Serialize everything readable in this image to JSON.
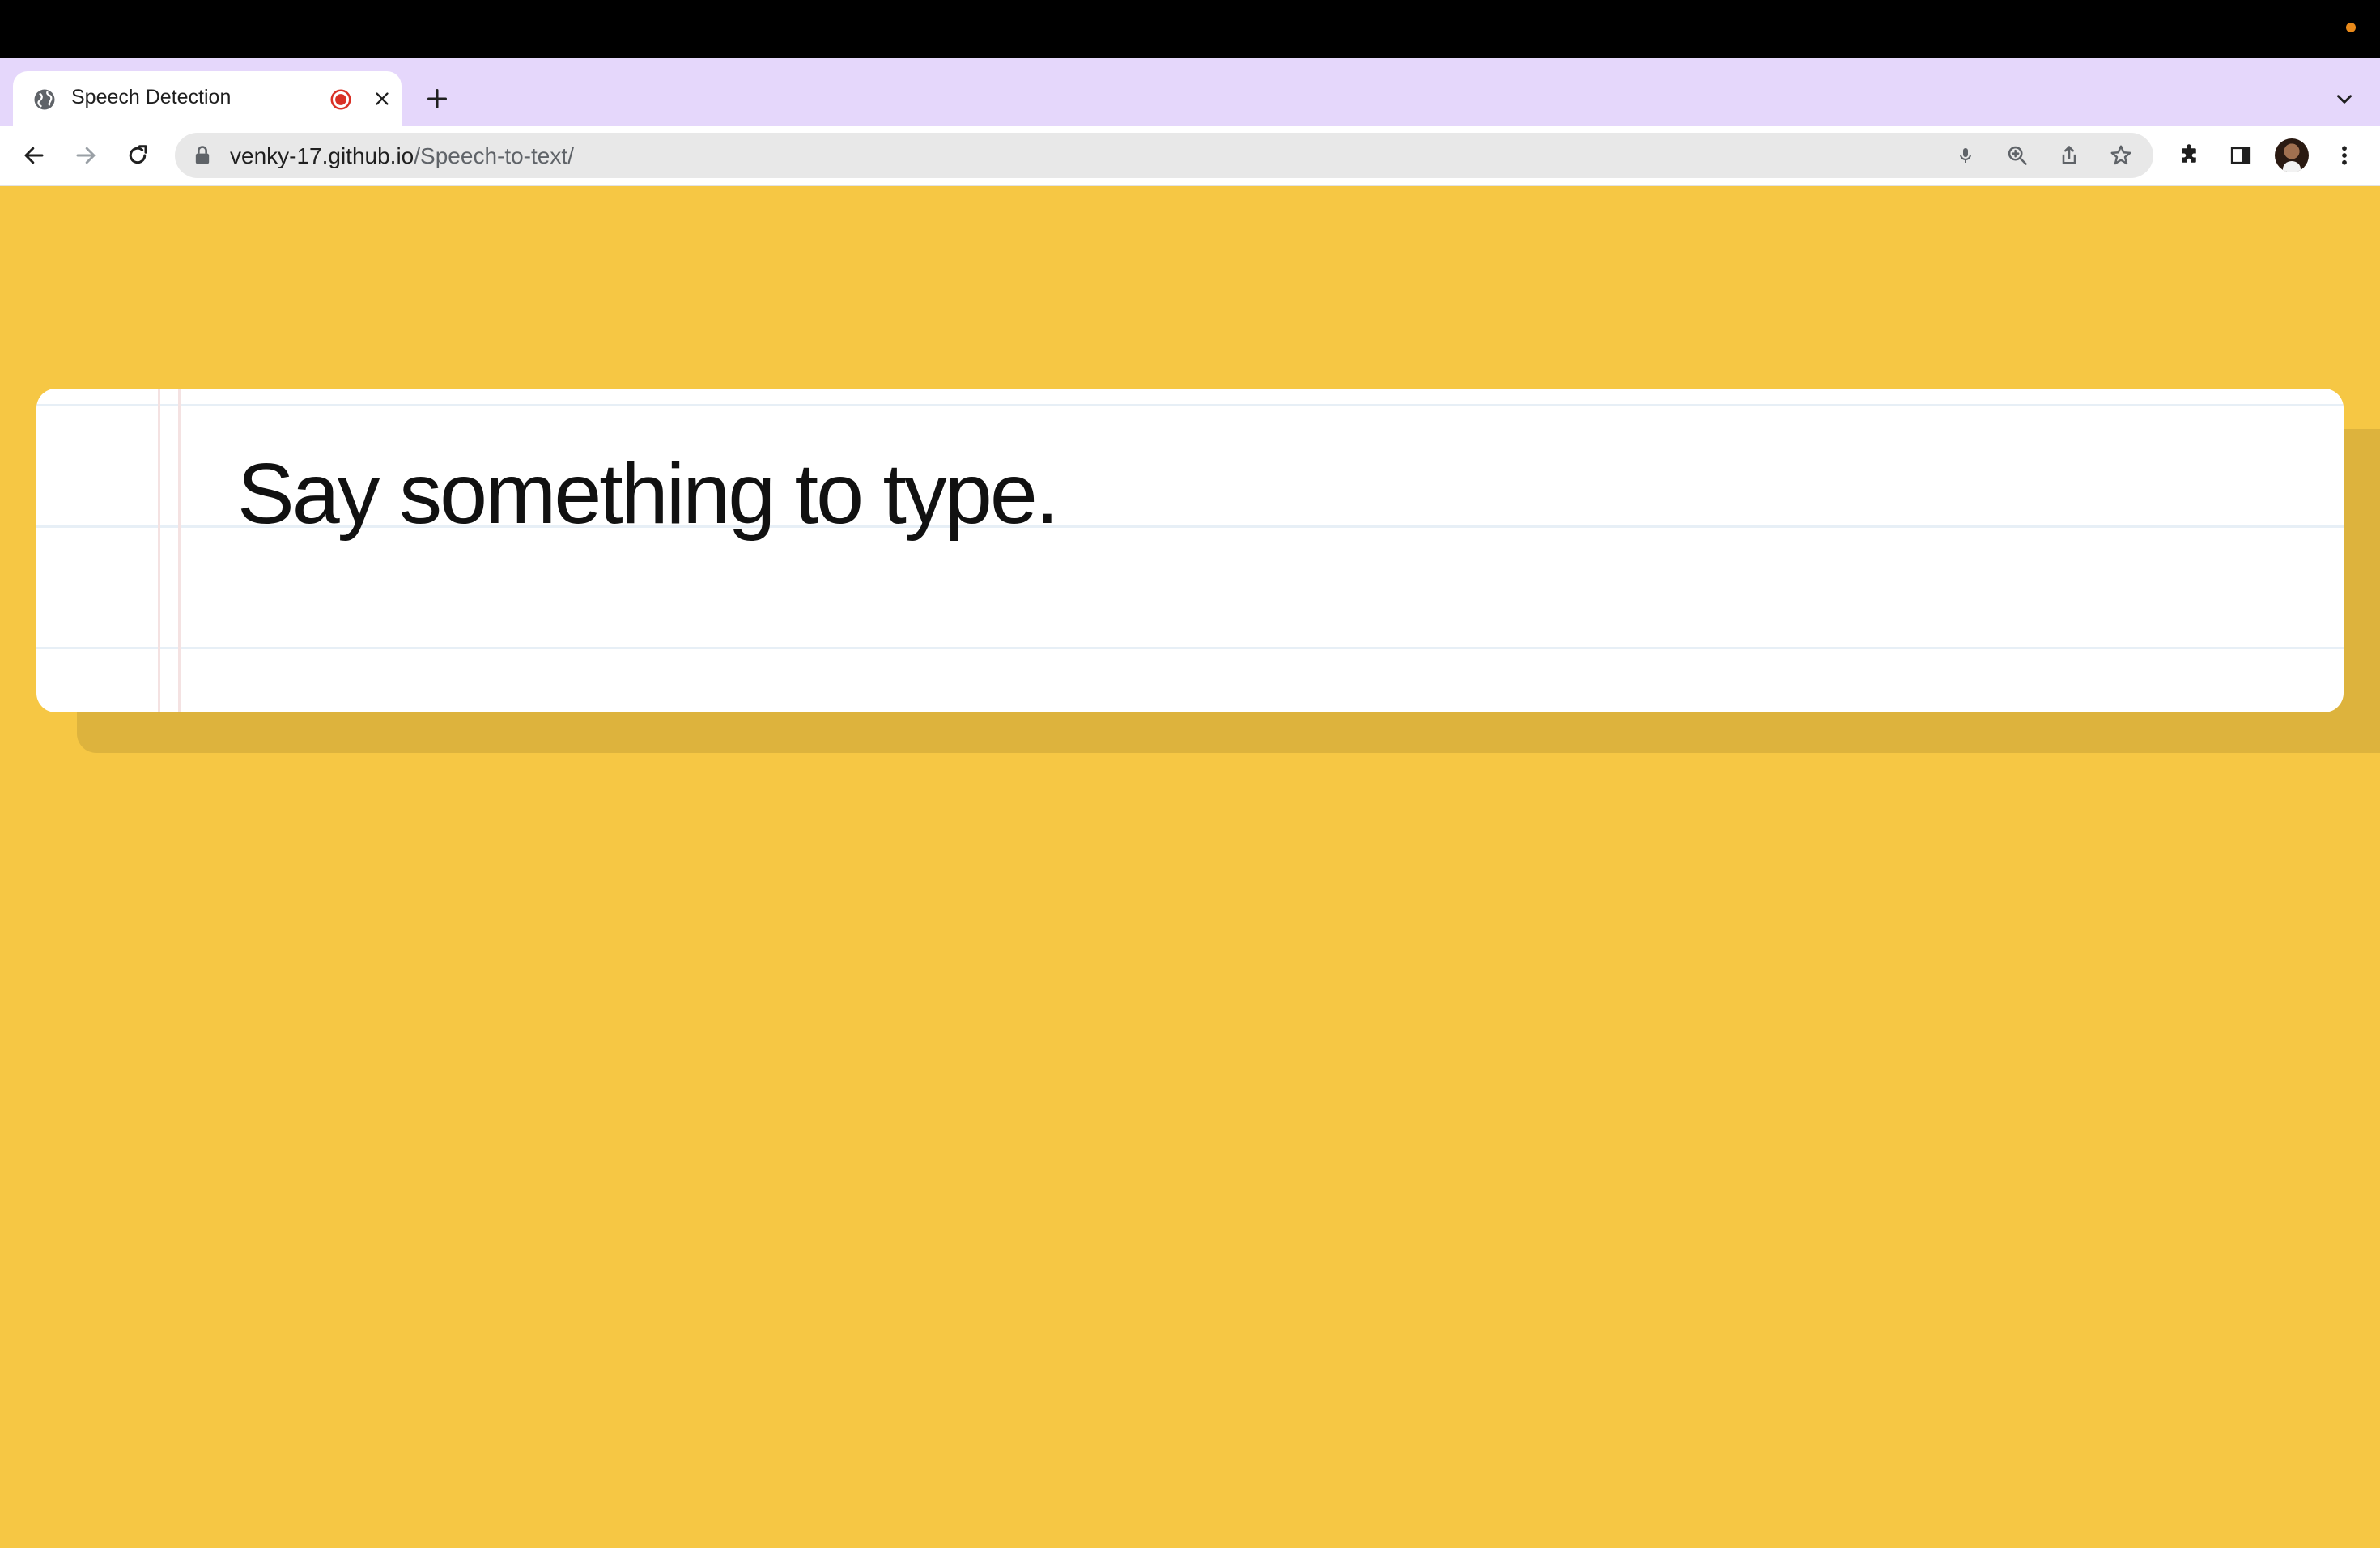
{
  "browser": {
    "tab": {
      "title": "Speech Detection",
      "favicon": "globe-icon",
      "media_indicator": "recording-icon"
    },
    "url": {
      "domain": "venky-17.github.io",
      "path": "/Speech-to-text/"
    },
    "icons": [
      "back-icon",
      "forward-icon",
      "reload-icon",
      "lock-icon",
      "microphone-icon",
      "zoom-icon",
      "share-icon",
      "star-icon",
      "extensions-icon",
      "side-panel-icon",
      "avatar",
      "menu-icon"
    ]
  },
  "page": {
    "background_color": "#f6c744",
    "paper_color": "#ffffff",
    "text": "Say something to type."
  }
}
